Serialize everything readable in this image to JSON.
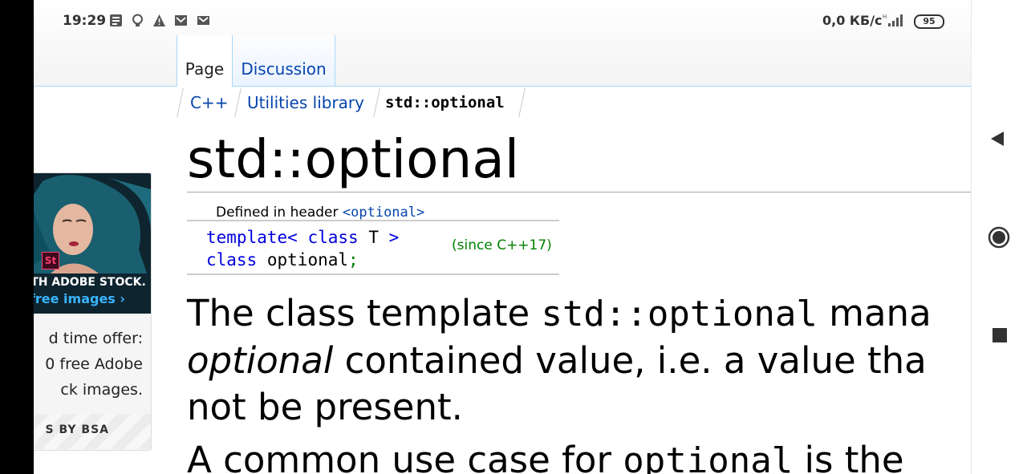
{
  "status_bar": {
    "time": "19:29",
    "network_speed": "0,0 КБ/с",
    "network_type": "H",
    "battery": "95"
  },
  "tabs": {
    "page": "Page",
    "discussion": "Discussion"
  },
  "breadcrumb": {
    "c1": "C++",
    "c2": "Utilities library",
    "c3": "std::optional"
  },
  "ad": {
    "tagline": "ITH ADOBE STOCK.",
    "link": "free images ›",
    "badge": "St",
    "text_lines": [
      "d time offer:",
      "0 free Adobe",
      "ck images."
    ],
    "footer": "S BY BSA"
  },
  "page": {
    "title": "std::optional",
    "defined_in_label": "Defined in header",
    "header_name": "<optional>",
    "code_line1_kw1": "template<",
    "code_line1_kw2": "class",
    "code_line1_t": "T",
    "code_line1_end": ">",
    "code_line2_kw": "class",
    "code_line2_name": "optional",
    "code_line2_end": ";",
    "since": "(since C++17)",
    "p1_line1_a": "The class template ",
    "p1_line1_code": "std::optional",
    "p1_line1_b": " mana",
    "p1_line2_em": "optional",
    "p1_line2_b": " contained value, i.e. a value tha",
    "p1_line3": "not be present.",
    "p2_a": "A common use case for ",
    "p2_code": "optional",
    "p2_b": " is the"
  },
  "colors": {
    "link": "#0645ad",
    "tab_border": "#a7d7f9",
    "since": "#008000"
  }
}
